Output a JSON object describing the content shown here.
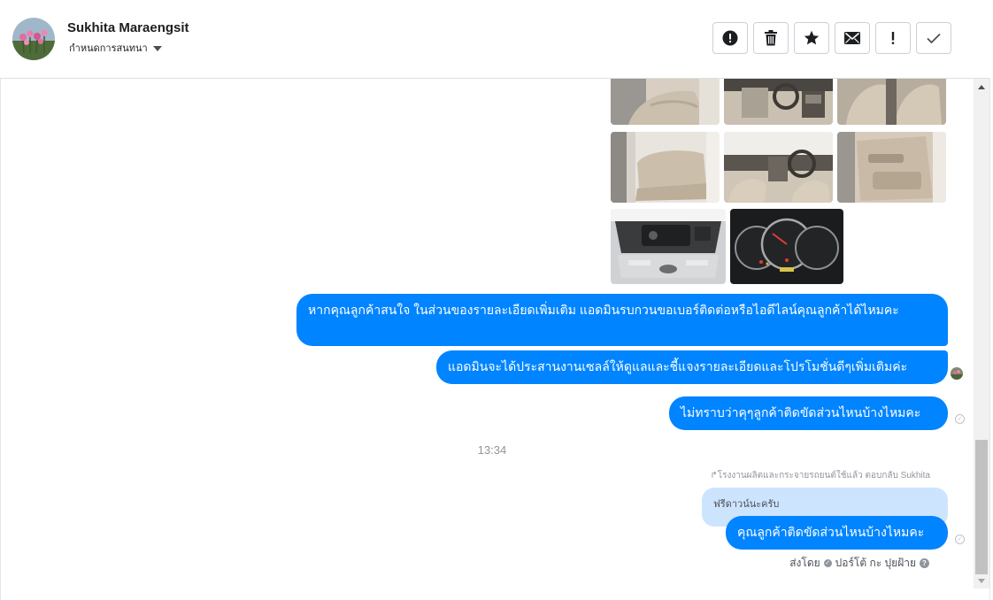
{
  "header": {
    "contact_name": "Sukhita Maraengsit",
    "assign_label": "กำหนดการสนทนา",
    "actions": [
      {
        "name": "spam-button",
        "icon": "alert-circle-icon"
      },
      {
        "name": "delete-button",
        "icon": "trash-icon"
      },
      {
        "name": "star-button",
        "icon": "star-icon"
      },
      {
        "name": "mark-unread-button",
        "icon": "envelope-icon"
      },
      {
        "name": "important-button",
        "icon": "exclamation-icon"
      },
      {
        "name": "mark-done-button",
        "icon": "checkmark-icon"
      }
    ]
  },
  "thread": {
    "photos": [
      {
        "subject": "car-interior-rear-seat"
      },
      {
        "subject": "car-interior-dashboard"
      },
      {
        "subject": "car-interior-front-seats"
      },
      {
        "subject": "car-rear-seats"
      },
      {
        "subject": "car-dashboard-steering"
      },
      {
        "subject": "car-door-panel"
      },
      {
        "subject": "car-engine-bay"
      },
      {
        "subject": "car-instrument-cluster"
      }
    ],
    "messages": [
      {
        "text": "หากคุณลูกค้าสนใจ ในส่วนของรายละเอียดเพิ่มเติม แอดมินรบกวนขอเบอร์ติดต่อหรือไอดีไลน์คุณลูกค้าได้ไหมคะ"
      },
      {
        "text": "แอดมินจะได้ประสานงานเซลล์ให้ดูแลและชี้แจงรายละเอียดและโปรโมชั่นดีๆเพิ่มเติมค่ะ"
      },
      {
        "text": "ไม่ทราบว่าคุๆลูกค้าติดขัดส่วนไหนบ้างไหมคะ"
      }
    ],
    "timestamp": "13:34",
    "reply_meta": "โรงงานผลิตและกระจายรถยนต์ใช้แล้ว ตอบกลับ Sukhita",
    "quoted_text": "ฟรีดาวน์นะครับ",
    "reply_message": "คุณลูกค้าติดขัดส่วนไหนบ้างไหมคะ",
    "sent_by_label": "ส่งโดย",
    "sent_by_name": "ปอร์โต้ กะ ปุยฝ้าย"
  },
  "colors": {
    "bubble": "#0084ff",
    "quote_bubble": "#cde4ff",
    "border": "#ccd0d5",
    "meta_text": "#90949c"
  }
}
